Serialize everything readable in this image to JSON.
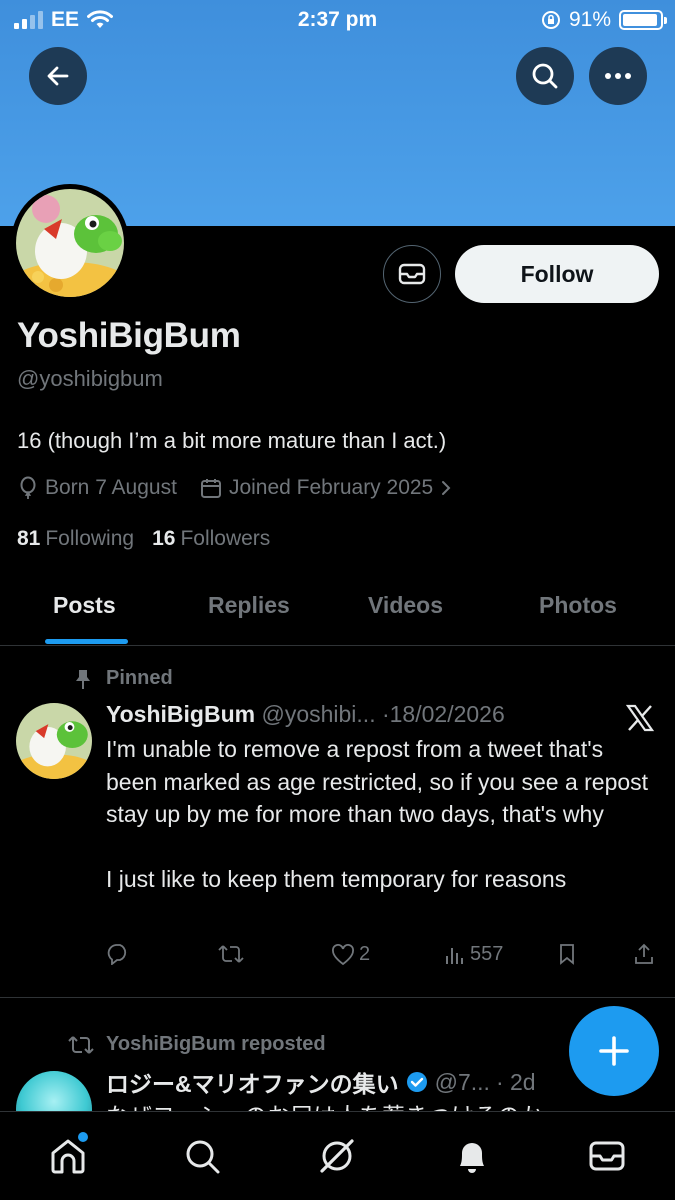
{
  "status_bar": {
    "carrier": "EE",
    "time": "2:37 pm",
    "battery": "91%"
  },
  "profile": {
    "display_name": "YoshiBigBum",
    "handle": "@yoshibigbum",
    "bio": "16 (though I’m a bit more mature than I act.)",
    "born": "Born 7 August",
    "joined": "Joined February 2025",
    "following_count": "81",
    "following_label": "Following",
    "followers_count": "16",
    "followers_label": "Followers",
    "follow_label": "Follow"
  },
  "tabs": [
    {
      "label": "Posts",
      "active": true
    },
    {
      "label": "Replies",
      "active": false
    },
    {
      "label": "Videos",
      "active": false
    },
    {
      "label": "Photos",
      "active": false
    }
  ],
  "pinned_post": {
    "pinned_label": "Pinned",
    "author": "YoshiBigBum",
    "handle": "@yoshibi...",
    "date": "·18/02/2026",
    "paragraph1": "I'm unable to remove a repost from a tweet that's been marked as age restricted, so if you see a repost stay up by me for more than two days, that's why",
    "paragraph2": "I just like to keep them temporary for reasons",
    "likes": "2",
    "views": "557"
  },
  "repost": {
    "repost_label": "YoshiBigBum reposted",
    "author": "ロジー&マリオファンの集い",
    "handle": "@7...",
    "date": "· 2d",
    "text": "なぜヨッシーのお尻は人を惹きつけるのか"
  },
  "colors": {
    "accent": "#1d9bf0",
    "banner": "#4a9ce6",
    "muted": "#71767b"
  }
}
